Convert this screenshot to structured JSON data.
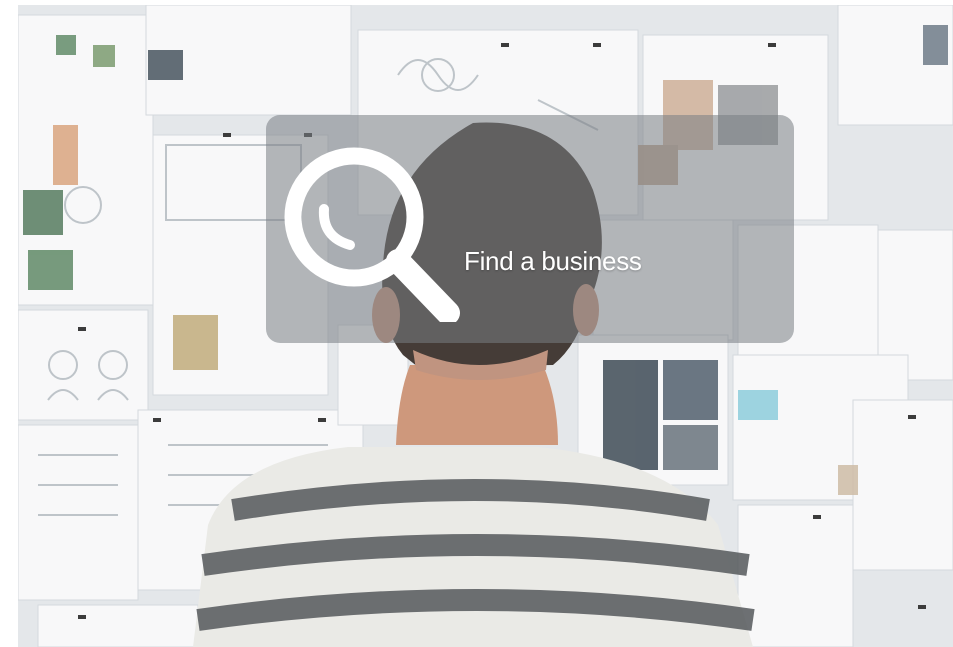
{
  "hero": {
    "image_icon": "photo-person-at-moodboard",
    "overlay_color": "#787d84",
    "search": {
      "icon": "magnifier-icon",
      "label": "Find a business"
    }
  }
}
